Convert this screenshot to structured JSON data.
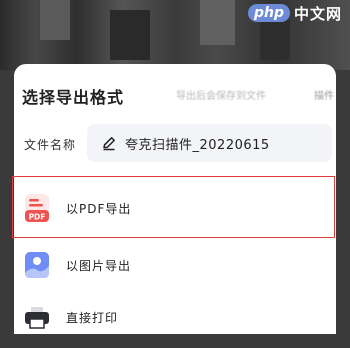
{
  "watermark": {
    "logo": "php",
    "text": "中文网"
  },
  "sheet": {
    "title": "选择导出格式",
    "hint": "导出后会保存到文件",
    "hint_tail": "描件",
    "filename_label": "文件名称",
    "filename_value": "夸克扫描件_20220615",
    "options": [
      {
        "label": "以PDF导出",
        "icon": "pdf-icon",
        "selected": true
      },
      {
        "label": "以图片导出",
        "icon": "image-icon",
        "selected": false
      },
      {
        "label": "直接打印",
        "icon": "printer-icon",
        "selected": false
      }
    ]
  },
  "colors": {
    "accent_red": "#e23b3b",
    "pdf_red": "#f0524f",
    "image_blue": "#5b7ff0",
    "printer_dark": "#2b2e35"
  }
}
